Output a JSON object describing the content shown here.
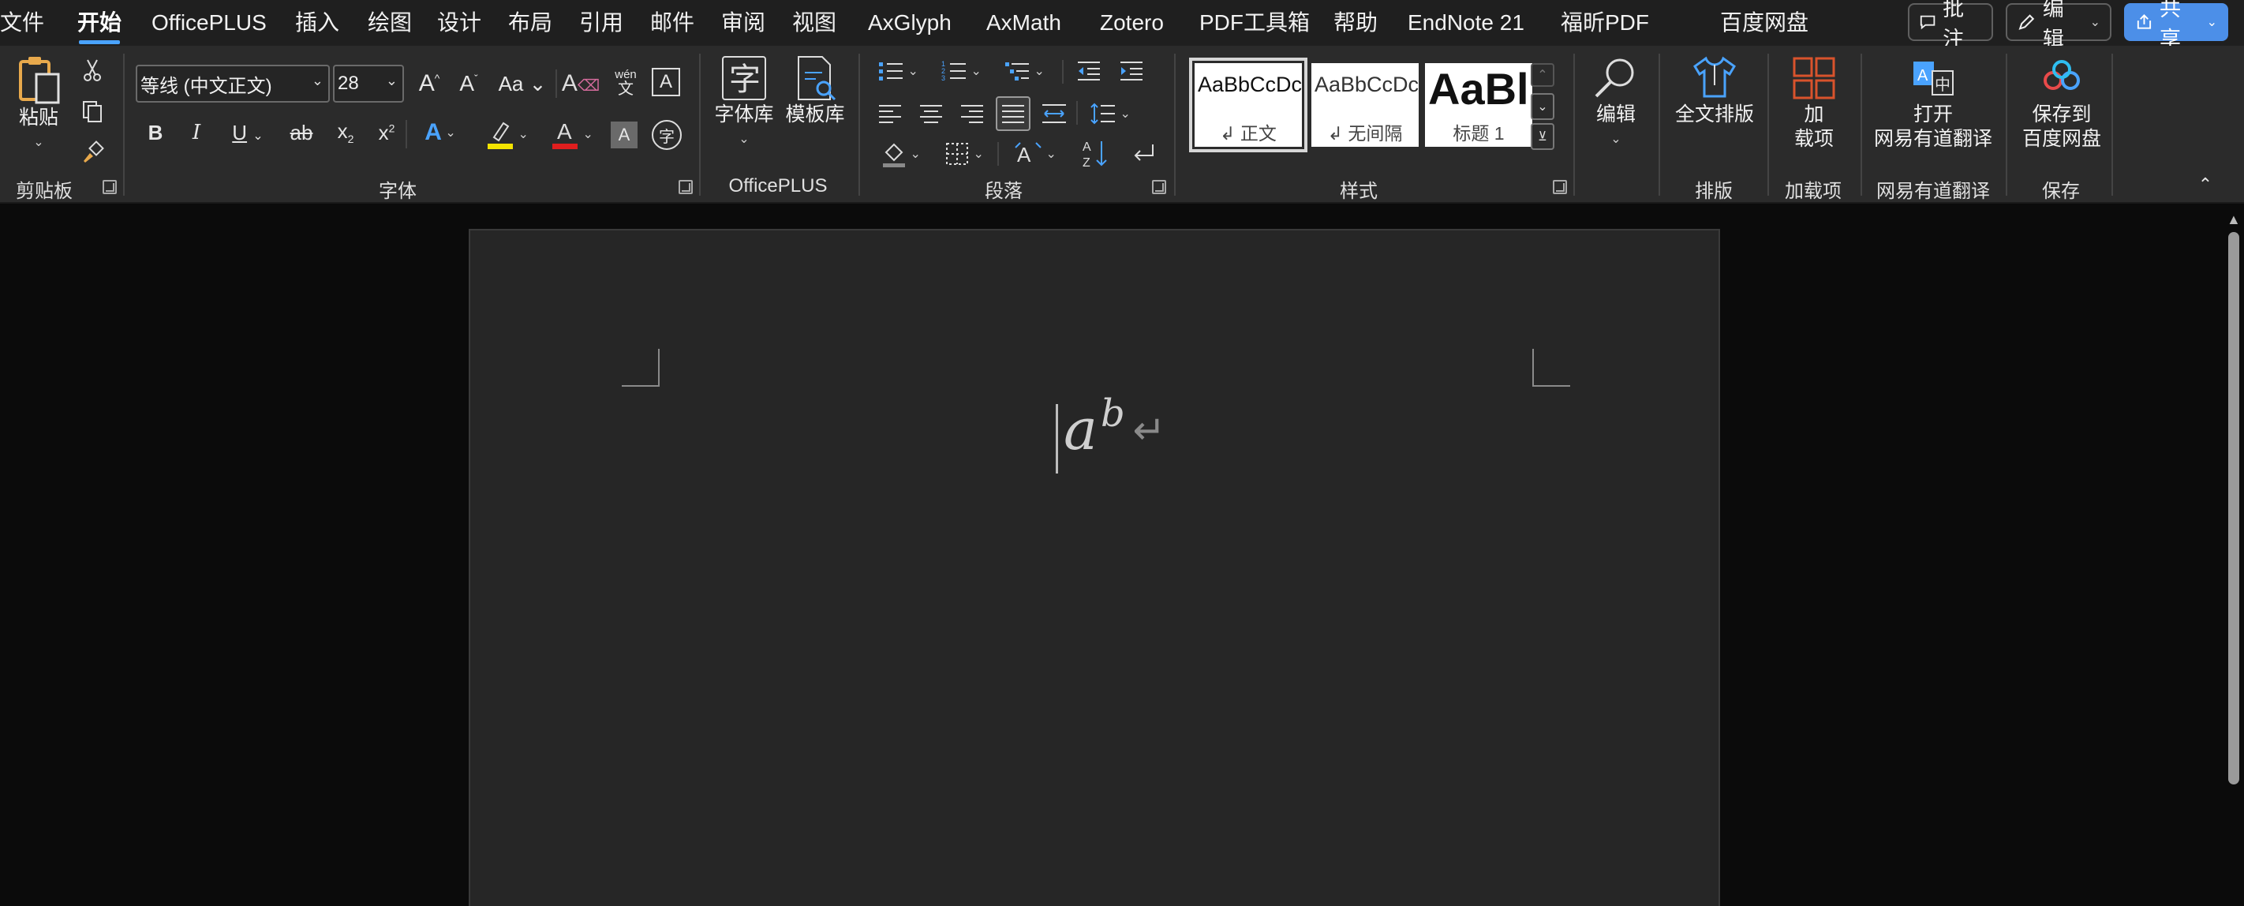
{
  "menu": {
    "items": [
      "文件",
      "开始",
      "OfficePLUS",
      "插入",
      "绘图",
      "设计",
      "布局",
      "引用",
      "邮件",
      "审阅",
      "视图",
      "AxGlyph",
      "AxMath",
      "Zotero",
      "PDF工具箱",
      "帮助",
      "EndNote 21",
      "福昕PDF",
      "百度网盘"
    ],
    "active": "开始"
  },
  "topbar": {
    "comment": "批注",
    "edit": "编辑",
    "share": "共享"
  },
  "ribbon": {
    "clipboard": {
      "paste": "粘贴",
      "label": "剪贴板"
    },
    "font": {
      "name": "等线 (中文正文)",
      "size": "28",
      "label": "字体",
      "wen_top": "wén",
      "wen_bottom": "文"
    },
    "officeplus": {
      "fontlib": "字体库",
      "templatelib": "模板库",
      "label": "OfficePLUS"
    },
    "paragraph": {
      "label": "段落"
    },
    "styles": {
      "label": "样式",
      "tiles": [
        {
          "sample": "AaBbCcDc",
          "name": "↲ 正文"
        },
        {
          "sample": "AaBbCcDc",
          "name": "↲ 无间隔"
        },
        {
          "sample": "AaBl",
          "name": "标题 1"
        }
      ]
    },
    "editing": {
      "label": "编辑"
    },
    "layout": {
      "button": "全文排版",
      "label": "排版"
    },
    "addins": {
      "button1": "加",
      "button2": "载项",
      "label": "加载项"
    },
    "youdao": {
      "button1": "打开",
      "button2": "网易有道翻译",
      "label": "网易有道翻译"
    },
    "save": {
      "button1": "保存到",
      "button2": "百度网盘",
      "label": "保存"
    }
  },
  "document": {
    "base": "a",
    "superscript": "b",
    "paragraph_mark": "↵"
  }
}
